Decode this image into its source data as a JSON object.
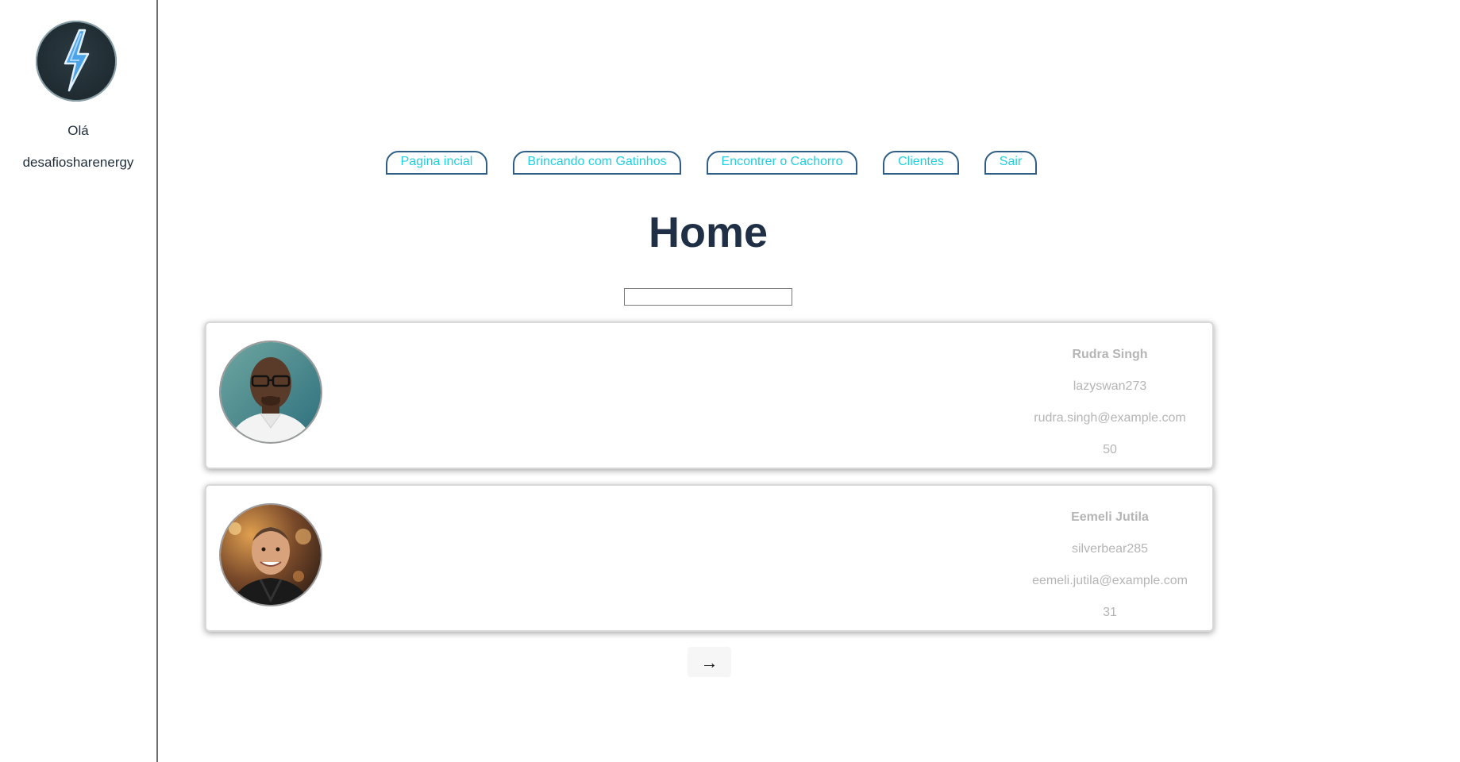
{
  "sidebar": {
    "logo_icon": "lightning-bolt-icon",
    "greeting": "Olá",
    "username": "desafiosharenergy"
  },
  "nav": {
    "items": [
      {
        "label": "Pagina incial"
      },
      {
        "label": "Brincando com Gatinhos"
      },
      {
        "label": "Encontrer o Cachorro"
      },
      {
        "label": "Clientes"
      },
      {
        "label": "Sair"
      }
    ]
  },
  "page": {
    "title": "Home",
    "search_value": ""
  },
  "users": [
    {
      "name": "Rudra Singh",
      "username": "lazyswan273",
      "email": "rudra.singh@example.com",
      "age": "50"
    },
    {
      "name": "Eemeli Jutila",
      "username": "silverbear285",
      "email": "eemeli.jutila@example.com",
      "age": "31"
    }
  ],
  "pagination": {
    "next_label": "→"
  },
  "colors": {
    "nav_text": "#1fd0e0",
    "nav_border": "#2f5f86",
    "title": "#1f2f45",
    "card_text": "#b5b5b5"
  }
}
